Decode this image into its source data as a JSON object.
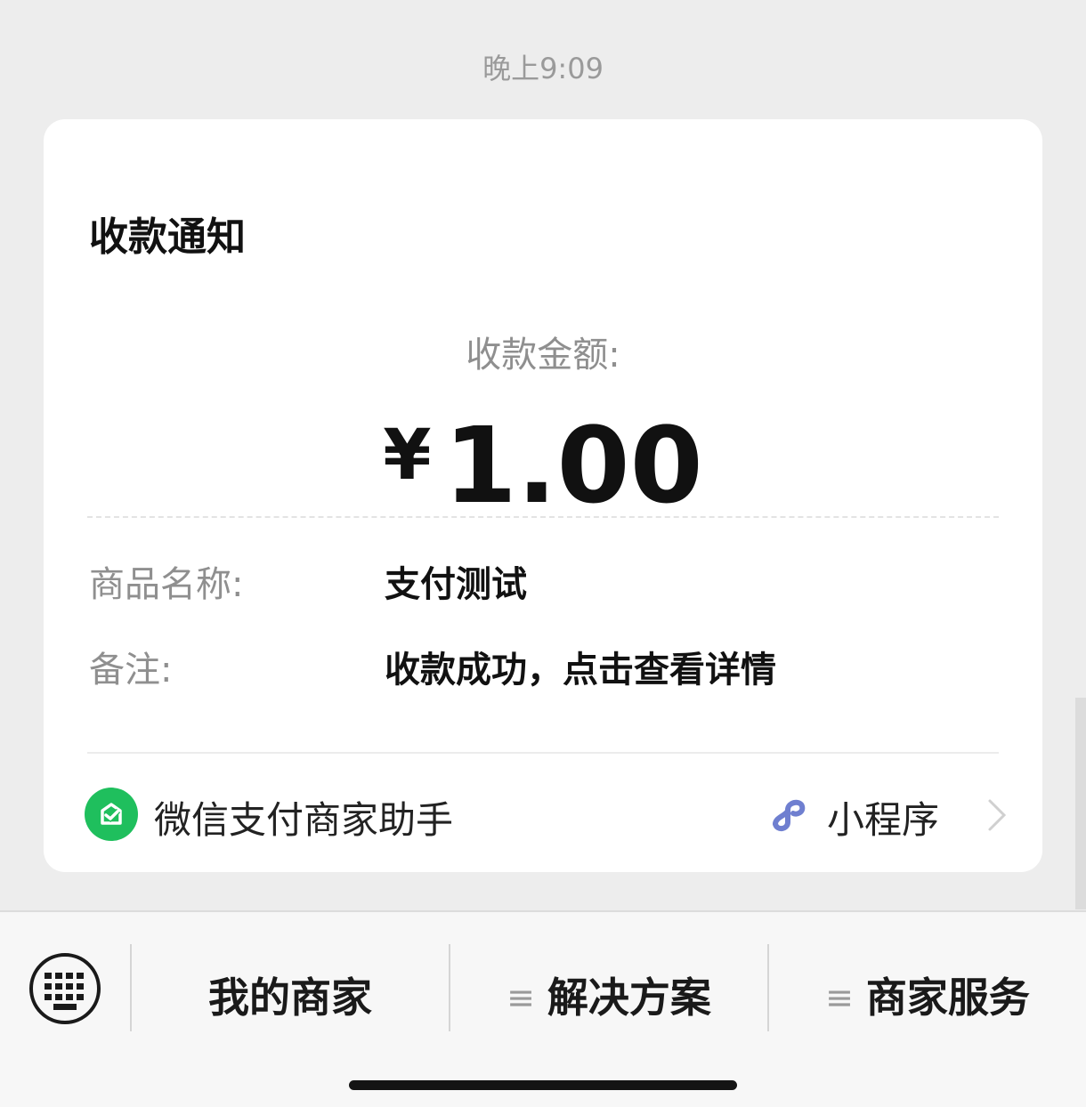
{
  "timestamp": "晚上9:09",
  "card": {
    "title": "收款通知",
    "amount_label": "收款金额:",
    "currency": "¥",
    "amount": "1.00",
    "fields": [
      {
        "label": "商品名称:",
        "value": "支付测试"
      },
      {
        "label": "备注:",
        "value": "收款成功，点击查看详情"
      }
    ],
    "footer": {
      "app_name": "微信支付商家助手",
      "mini_program_label": "小程序",
      "app_icon": "wechat-pay-merchant-icon",
      "mini_icon": "mini-program-icon"
    }
  },
  "bottom_menu": {
    "keyboard_icon": "keyboard-icon",
    "items": [
      {
        "label": "我的商家",
        "hamburger": false
      },
      {
        "label": "解决方案",
        "hamburger": true
      },
      {
        "label": "商家服务",
        "hamburger": true
      }
    ],
    "hamburger_glyph": "≡"
  },
  "colors": {
    "background": "#ededed",
    "card": "#ffffff",
    "accent_green": "#1fbf5d",
    "mini_program_blue": "#6f7fd0"
  }
}
